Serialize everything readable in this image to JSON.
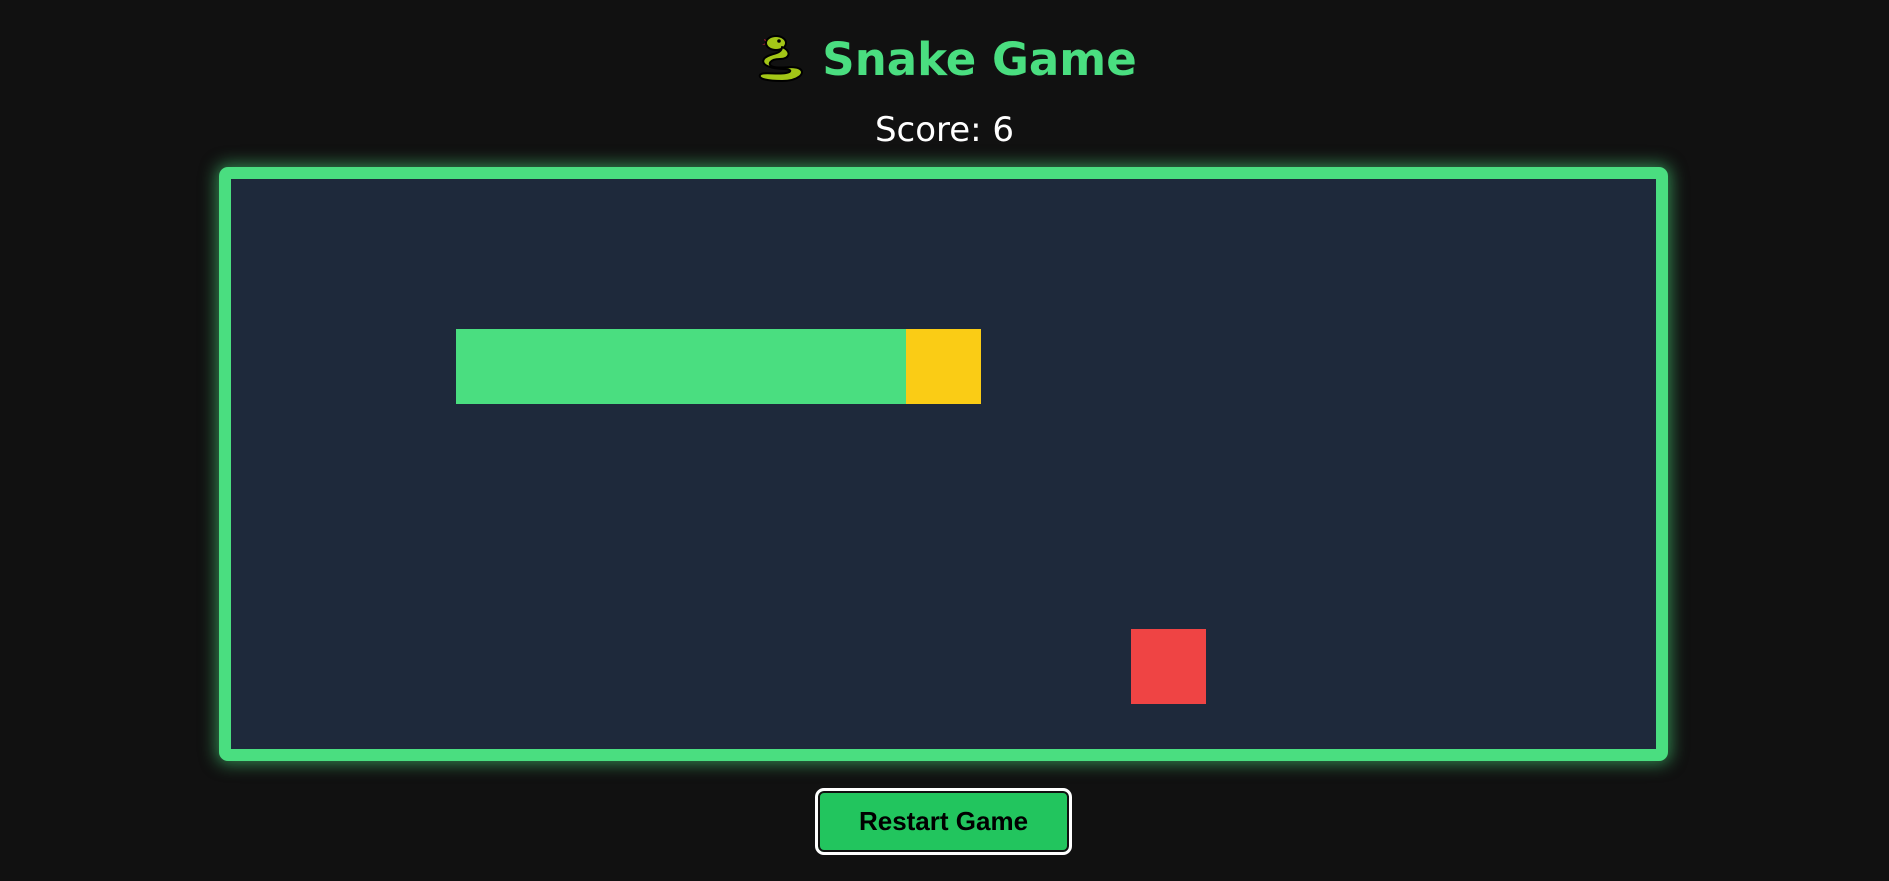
{
  "header": {
    "title": "Snake Game",
    "icon": "snake-icon"
  },
  "score": {
    "text": "Score: 6",
    "value": 6
  },
  "board": {
    "grid_columns": 19,
    "grid_rows": 7.6,
    "snake": {
      "head": [
        9,
        2
      ],
      "body": [
        [
          8,
          2
        ],
        [
          7,
          2
        ],
        [
          6,
          2
        ],
        [
          5,
          2
        ],
        [
          4,
          2
        ],
        [
          3,
          2
        ]
      ]
    },
    "food": [
      12,
      6
    ],
    "colors": {
      "background": "#1e293b",
      "border": "#4ade80",
      "snake_body": "#4ade80",
      "snake_head": "#facc15",
      "food": "#ef4444"
    }
  },
  "controls": {
    "restart_label": "Restart Game"
  },
  "colors": {
    "page_background": "#111111",
    "accent": "#4ade80",
    "button": "#22c55e"
  }
}
